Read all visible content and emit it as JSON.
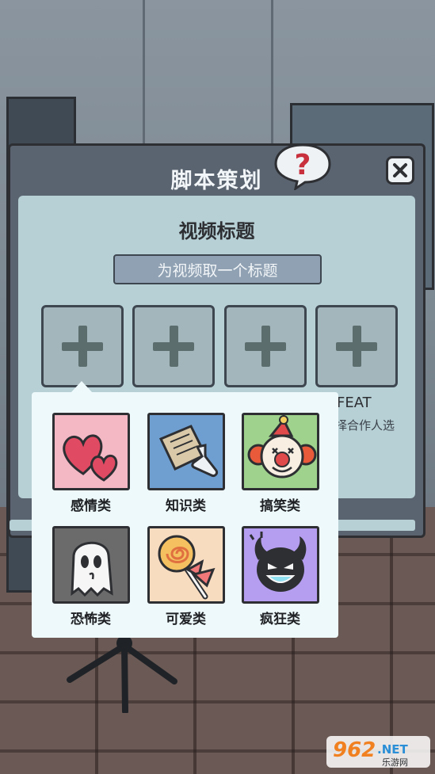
{
  "dialog": {
    "title": "脚本策划",
    "help_icon": "question-mark-icon",
    "close_icon": "close-icon"
  },
  "video_section": {
    "title": "视频标题",
    "title_placeholder": "为视频取一个标题",
    "slots": [
      {
        "icon": "plus-icon"
      },
      {
        "icon": "plus-icon"
      },
      {
        "icon": "plus-icon"
      },
      {
        "icon": "plus-icon"
      }
    ],
    "feat_label": "FEAT",
    "collab_hint": "择合作人选"
  },
  "categories": [
    {
      "label": "感情类",
      "icon": "hearts-icon",
      "color": "#f4b7c4"
    },
    {
      "label": "知识类",
      "icon": "paper-flask-icon",
      "color": "#6f9fd0"
    },
    {
      "label": "搞笑类",
      "icon": "clown-icon",
      "color": "#9fd28c"
    },
    {
      "label": "恐怖类",
      "icon": "ghost-icon",
      "color": "#6b6b6b"
    },
    {
      "label": "可爱类",
      "icon": "lollipop-icon",
      "color": "#f8dcc0"
    },
    {
      "label": "疯狂类",
      "icon": "devil-icon",
      "color": "#b59ef0"
    }
  ],
  "watermark": {
    "brand": "962.NET",
    "sub": "乐游网"
  }
}
